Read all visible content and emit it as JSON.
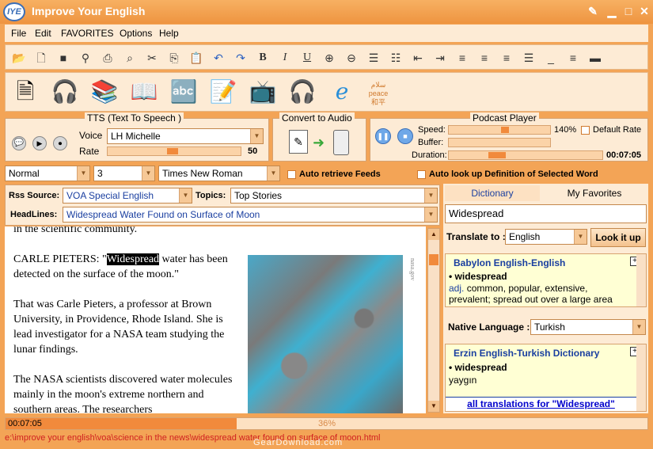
{
  "window": {
    "logo": "IYE",
    "title": "Improve Your English"
  },
  "menu": [
    "File",
    "Edit",
    "FAVORITES",
    "Options",
    "Help"
  ],
  "tts": {
    "title": "TTS (Text To Speech )",
    "voice_label": "Voice",
    "voice_value": "LH Michelle",
    "rate_label": "Rate",
    "rate_value": "50",
    "rate_level": 0.5
  },
  "convert": {
    "title": "Convert to Audio"
  },
  "podcast": {
    "title": "Podcast Player",
    "speed_label": "Speed:",
    "speed_value": "140%",
    "default_rate_label": "Default Rate",
    "buffer_label": "Buffer:",
    "duration_label": "Duration:",
    "duration_value": "00:07:05"
  },
  "format": {
    "style": "Normal",
    "size": "3",
    "font": "Times New Roman"
  },
  "options": {
    "auto_feeds": "Auto retrieve Feeds",
    "auto_lookup": "Auto look up Definition of Selected Word"
  },
  "feeds": {
    "rss_label": "Rss Source:",
    "rss_value": "VOA Special English",
    "topics_label": "Topics:",
    "topics_value": "Top Stories",
    "headlines_label": "HeadLines:",
    "headlines_value": "Widespread Water Found on Surface of Moon"
  },
  "article": {
    "line0": "in the scientific community.",
    "p1_prefix": "CARLE PIETERS: \"",
    "p1_highlight": "Widespread",
    "p1_rest": " water has been detected on the surface of the moon.\"",
    "p2": "That was Carle Pieters, a professor at Brown University, in Providence, Rhode Island. She is lead investigator for a NASA team studying the lunar findings.",
    "p3": "The NASA scientists discovered water molecules mainly in the moon's extreme northern and southern areas. The researchers",
    "image_credit": "nasa.gov"
  },
  "dictionary": {
    "tab_dictionary": "Dictionary",
    "tab_favorites": "My Favorites",
    "word": "Widespread",
    "translate_label": "Translate to :",
    "translate_value": "English",
    "lookup_button": "Look it up",
    "card1_title": "Babylon English-English",
    "card1_word": "widespread",
    "card1_pos": "adj.",
    "card1_def": " common, popular, extensive, prevalent; spread out over a large area",
    "native_label": "Native Language :",
    "native_value": "Turkish",
    "card2_title": "Erzin English-Turkish Dictionary",
    "card2_word": "widespread",
    "card2_def": "yaygın",
    "all_translations": "all translations for \"Widespread\""
  },
  "status": {
    "time": "00:07:05",
    "progress": "36%",
    "progress_level": 0.36
  },
  "path": "e:\\improve your english\\voa\\science in the news\\widespread water found on surface of moon.html",
  "watermark": "GearDownload.com",
  "colors": {
    "accent": "#f18a3c",
    "title_text": "#ffffff",
    "link": "#0000cc",
    "dict_title": "#1a3fa0"
  }
}
